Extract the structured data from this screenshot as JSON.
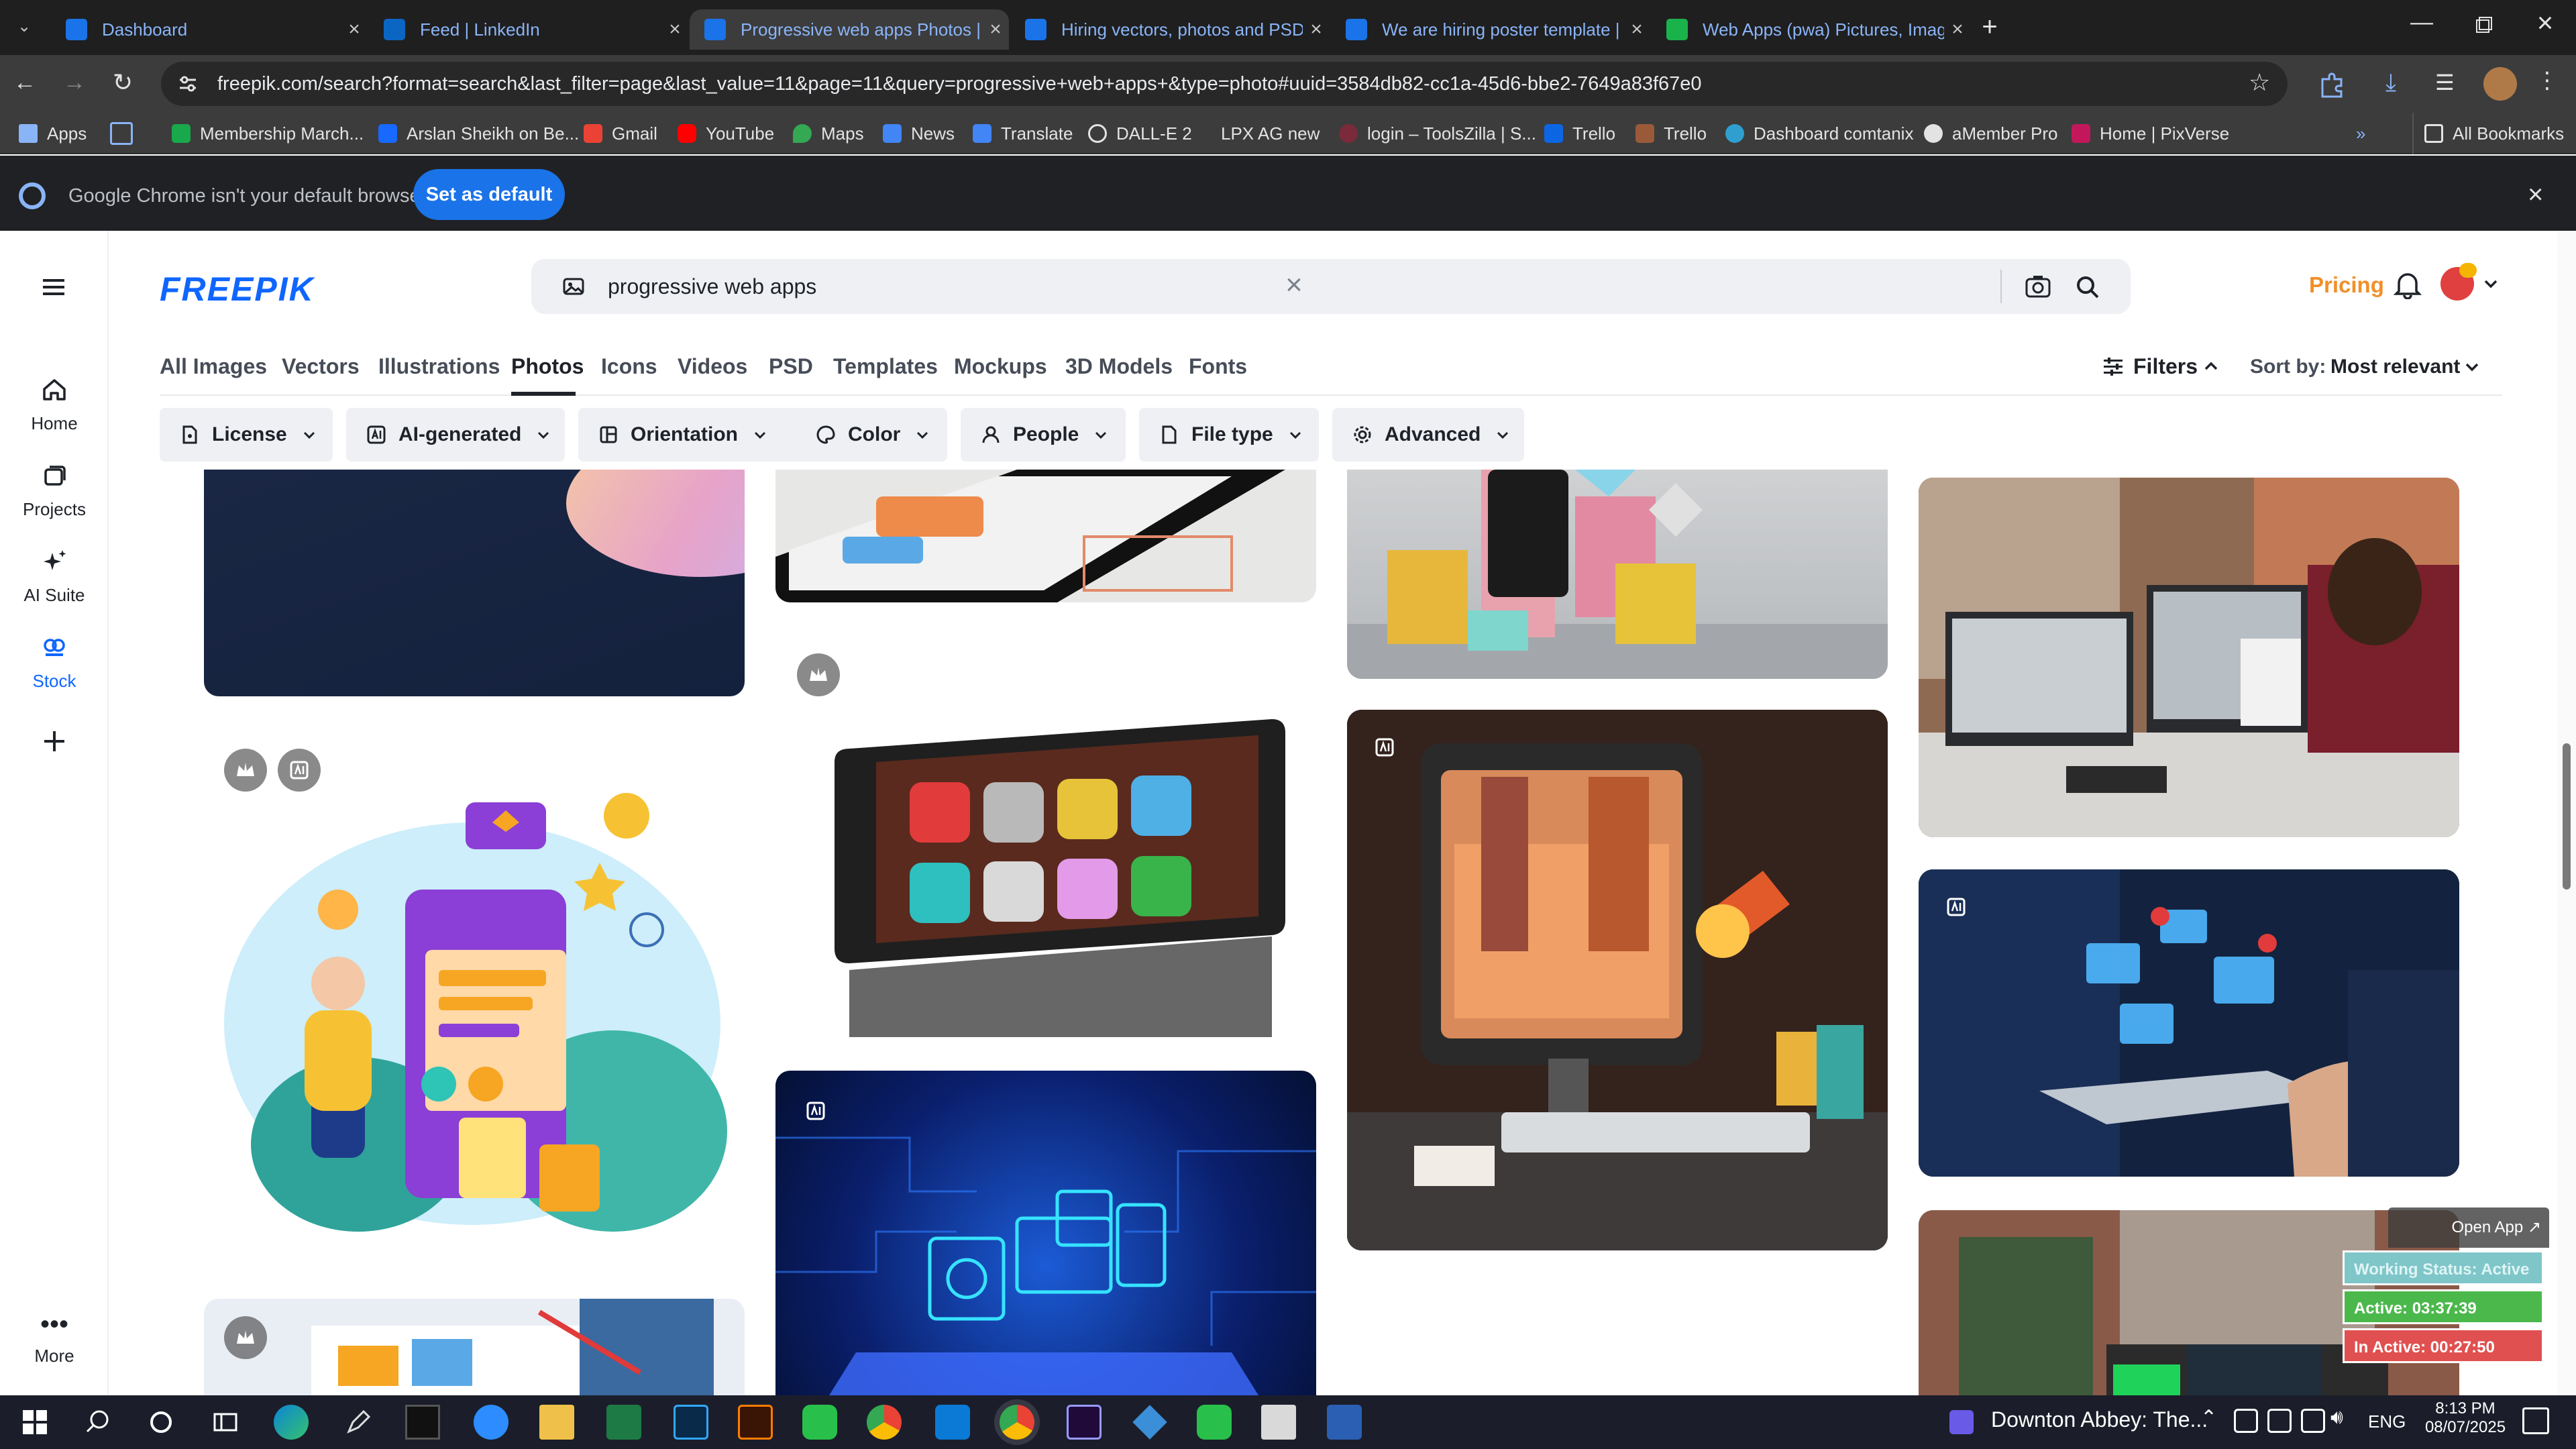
{
  "browser": {
    "tabs": [
      {
        "title": "Dashboard",
        "color": "#1a73e8",
        "active": false
      },
      {
        "title": "Feed | LinkedIn",
        "color": "#0a66c2",
        "active": false
      },
      {
        "title": "Progressive web apps Photos | Fr",
        "color": "#1a73e8",
        "active": true
      },
      {
        "title": "Hiring vectors, photos and PSD",
        "color": "#1a73e8",
        "active": false
      },
      {
        "title": "We are hiring poster template |",
        "color": "#1a73e8",
        "active": false
      },
      {
        "title": "Web Apps (pwa) Pictures, Images",
        "color": "#19b24b",
        "active": false
      }
    ],
    "url": "freepik.com/search?format=search&last_filter=page&last_value=11&page=11&query=progressive+web+apps+&type=photo#uuid=3584db82-cc1a-45d6-bbe2-7649a83f67e0",
    "bookmarks": [
      "Apps",
      "Membership March...",
      "Arslan Sheikh on Be...",
      "Gmail",
      "YouTube",
      "Maps",
      "News",
      "Translate",
      "DALL-E 2",
      "LPX AG new",
      "login – ToolsZilla | S...",
      "Trello",
      "Trello",
      "Dashboard comtanix",
      "aMember Pro",
      "Home | PixVerse"
    ],
    "all_bookmarks": "All Bookmarks",
    "infobar_text": "Google Chrome isn't your default browser",
    "set_default": "Set as default"
  },
  "site": {
    "logo": "FREEPIK",
    "search_value": "progressive web apps",
    "pricing": "Pricing",
    "sidebar": [
      {
        "label": "Home"
      },
      {
        "label": "Projects"
      },
      {
        "label": "AI Suite"
      },
      {
        "label": "Stock"
      }
    ],
    "more": "More",
    "tabs": [
      "All Images",
      "Vectors",
      "Illustrations",
      "Photos",
      "Icons",
      "Videos",
      "PSD",
      "Templates",
      "Mockups",
      "3D Models",
      "Fonts"
    ],
    "active_tab": "Photos",
    "filters_label": "Filters",
    "sort_label": "Sort by:",
    "sort_value": "Most relevant",
    "filter_chips": [
      "License",
      "AI-generated",
      "Orientation",
      "Color",
      "People",
      "File type",
      "Advanced"
    ]
  },
  "widget": {
    "open_app": "Open App ↗",
    "working": "Working Status: Active",
    "active": "Active: 03:37:39",
    "inactive": "In Active: 00:27:50"
  },
  "taskbar": {
    "media": "Downton Abbey: The...",
    "lang": "ENG",
    "time": "8:13 PM",
    "date": "08/07/2025"
  }
}
